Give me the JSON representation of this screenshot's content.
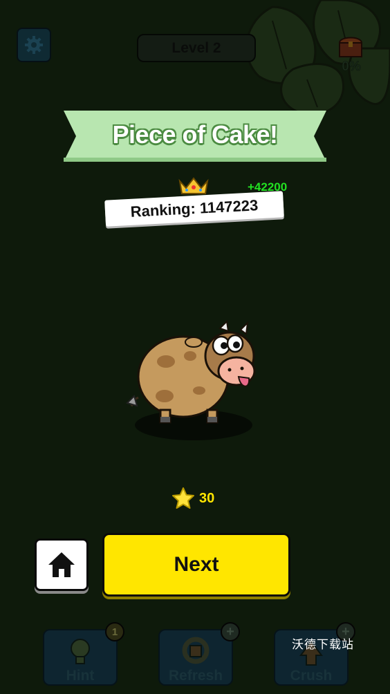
{
  "header": {
    "level_label": "Level 2",
    "chest_progress": "0%"
  },
  "result": {
    "banner_title": "Piece of Cake!",
    "ranking_text": "Ranking: 1147223",
    "score_gain": "+42200",
    "stars_earned": "30"
  },
  "actions": {
    "next_label": "Next"
  },
  "tools": [
    {
      "label": "Hint",
      "badge": "1"
    },
    {
      "label": "Refresh",
      "badge": "+"
    },
    {
      "label": "Crush",
      "badge": "+"
    }
  ],
  "watermark": "沃德下载站",
  "colors": {
    "background": "#0e1a0b",
    "banner_green": "#b8e6b0",
    "next_button": "#ffe600",
    "score_gain": "#22e022"
  },
  "icons": [
    "gear-icon",
    "treasure-chest-icon",
    "crown-icon",
    "star-icon",
    "home-icon",
    "lightbulb-icon",
    "refresh-icon",
    "crush-icon"
  ]
}
